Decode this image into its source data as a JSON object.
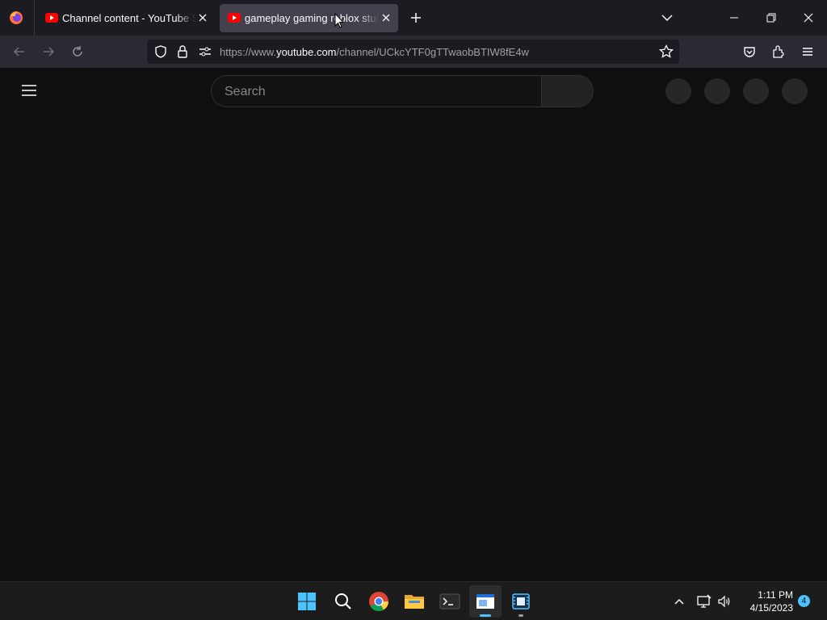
{
  "browser": {
    "tabs": [
      {
        "title": "Channel content - YouTube Studio",
        "active": false
      },
      {
        "title": "gameplay gaming roblox stuff",
        "active": true
      }
    ],
    "url_prefix": "https://www.",
    "url_host": "youtube.com",
    "url_path": "/channel/UCkcYTF0gTTwaobBTIW8fE4w"
  },
  "youtube": {
    "search_placeholder": "Search"
  },
  "taskbar": {
    "time": "1:11 PM",
    "date": "4/15/2023",
    "notification_count": "4"
  },
  "colors": {
    "tab_bar": "#1c1b22",
    "nav_bar": "#2b2a33",
    "page_bg": "#0f0f0f",
    "youtube_red": "#ff0000",
    "taskbar": "#1c1c1c",
    "windows_blue": "#4cc2ff"
  }
}
